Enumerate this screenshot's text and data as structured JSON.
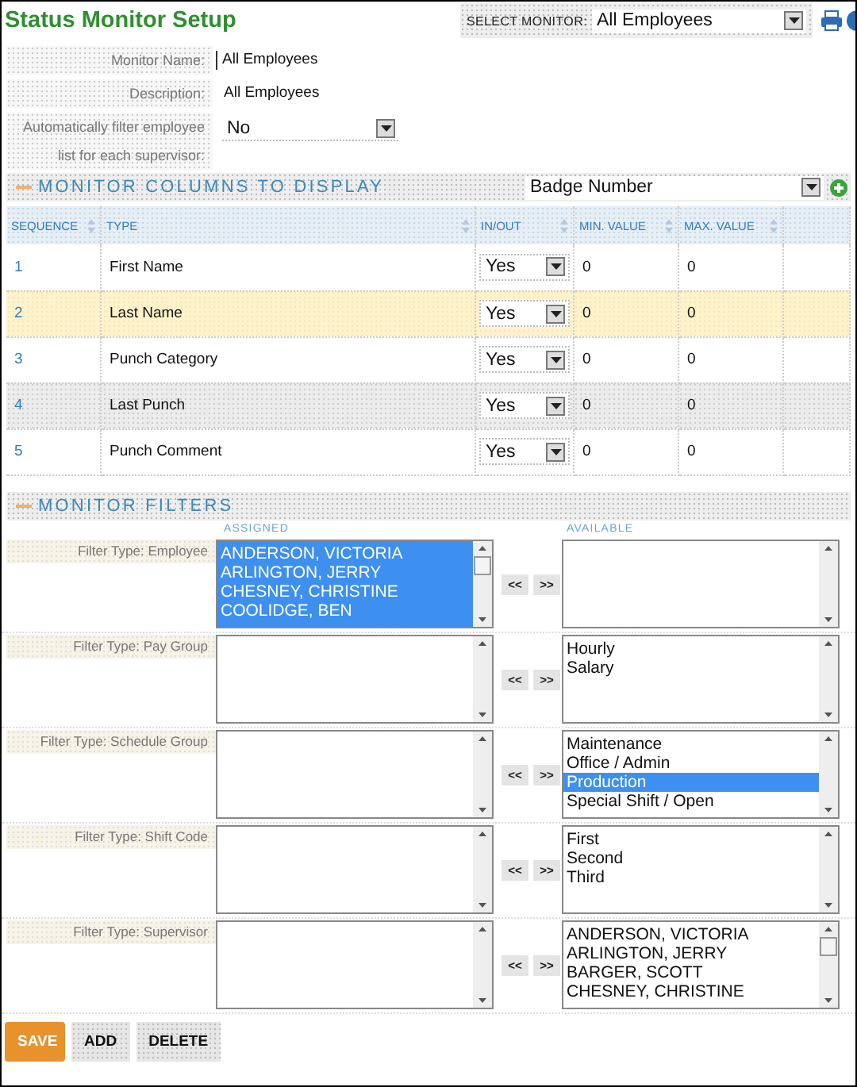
{
  "title": "Status Monitor Setup",
  "monitor_select": {
    "label": "SELECT MONITOR:",
    "value": "All Employees"
  },
  "form": [
    {
      "label": "Monitor Name:",
      "value": "All Employees",
      "kind": "input"
    },
    {
      "label": "Description:",
      "value": "All Employees",
      "kind": "text"
    },
    {
      "label": "Automatically filter employee list for each supervisor:",
      "value": "No",
      "kind": "select"
    }
  ],
  "columns_section": {
    "title": "MONITOR COLUMNS TO DISPLAY",
    "column_select": "Badge Number"
  },
  "table": {
    "columns": [
      "SEQUENCE",
      "TYPE",
      "IN/OUT",
      "MIN. VALUE",
      "MAX. VALUE"
    ],
    "rows": [
      {
        "sequence": "1",
        "type": "First Name",
        "in_out": "Yes",
        "min": "0",
        "max": "0",
        "kind": "plain"
      },
      {
        "sequence": "2",
        "type": "Last Name",
        "in_out": "Yes",
        "min": "0",
        "max": "0",
        "kind": "hover"
      },
      {
        "sequence": "3",
        "type": "Punch Category",
        "in_out": "Yes",
        "min": "0",
        "max": "0",
        "kind": "plain"
      },
      {
        "sequence": "4",
        "type": "Last Punch",
        "in_out": "Yes",
        "min": "0",
        "max": "0",
        "kind": "striped"
      },
      {
        "sequence": "5",
        "type": "Punch Comment",
        "in_out": "Yes",
        "min": "0",
        "max": "0",
        "kind": "plain"
      }
    ]
  },
  "filters_section": {
    "title": "MONITOR FILTERS",
    "assigned_label": "ASSIGNED",
    "available_label": "AVAILABLE"
  },
  "filters": [
    {
      "label": "Filter Type: Employee",
      "assigned": {
        "overflow": true,
        "items": [
          {
            "text": "ANDERSON, VICTORIA",
            "selected": true
          },
          {
            "text": "ARLINGTON, JERRY",
            "selected": true
          },
          {
            "text": "CHESNEY, CHRISTINE",
            "selected": true
          },
          {
            "text": "COOLIDGE, BEN",
            "selected": true
          }
        ]
      },
      "move_buttons": [
        "<<",
        ">>"
      ],
      "available": {
        "overflow": false
      }
    },
    {
      "label": "Filter Type: Pay Group",
      "assigned": {
        "overflow": false
      },
      "move_buttons": [
        "<<",
        ">>"
      ],
      "available": {
        "overflow": false,
        "items": [
          {
            "text": "Hourly",
            "selected": false
          },
          {
            "text": "Salary",
            "selected": false
          }
        ]
      }
    },
    {
      "label": "Filter Type: Schedule Group",
      "assigned": {
        "overflow": false
      },
      "move_buttons": [
        "<<",
        ">>"
      ],
      "available": {
        "overflow": false,
        "items": [
          {
            "text": "Maintenance",
            "selected": false
          },
          {
            "text": "Office / Admin",
            "selected": false
          },
          {
            "text": "Production",
            "selected": true
          },
          {
            "text": "Special Shift / Open",
            "selected": false
          }
        ]
      }
    },
    {
      "label": "Filter Type: Shift Code",
      "assigned": {
        "overflow": false
      },
      "move_buttons": [
        "<<",
        ">>"
      ],
      "available": {
        "overflow": false,
        "items": [
          {
            "text": "First",
            "selected": false
          },
          {
            "text": "Second",
            "selected": false
          },
          {
            "text": "Third",
            "selected": false
          }
        ]
      }
    },
    {
      "label": "Filter Type: Supervisor",
      "assigned": {
        "overflow": false
      },
      "move_buttons": [
        "<<",
        ">>"
      ],
      "available": {
        "overflow": true,
        "items": [
          {
            "text": "ANDERSON, VICTORIA",
            "selected": false
          },
          {
            "text": "ARLINGTON, JERRY",
            "selected": false
          },
          {
            "text": "BARGER, SCOTT",
            "selected": false
          },
          {
            "text": "CHESNEY, CHRISTINE",
            "selected": false
          }
        ]
      }
    }
  ],
  "buttons": [
    {
      "label": "SAVE",
      "kind": "primary"
    },
    {
      "label": "ADD",
      "kind": "secondary"
    },
    {
      "label": "DELETE",
      "kind": "secondary"
    }
  ]
}
